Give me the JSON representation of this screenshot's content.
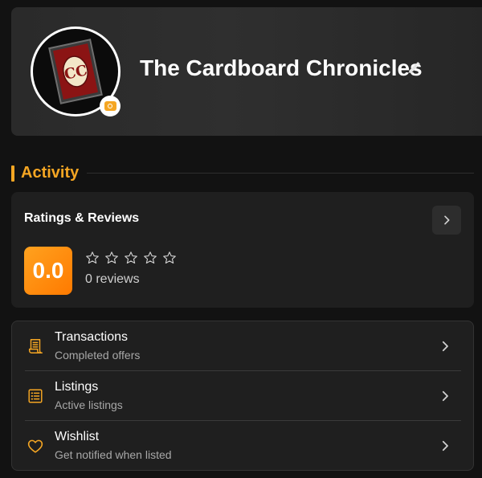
{
  "profile": {
    "name": "The Cardboard Chronicles",
    "avatar_monogram": "CC"
  },
  "activity": {
    "section_title": "Activity",
    "ratings": {
      "title": "Ratings & Reviews",
      "score": "0.0",
      "stars_filled": 0,
      "stars_total": 5,
      "review_count_text": "0 reviews"
    },
    "menu": [
      {
        "title": "Transactions",
        "subtitle": "Completed offers",
        "icon": "receipt-icon"
      },
      {
        "title": "Listings",
        "subtitle": "Active listings",
        "icon": "list-icon"
      },
      {
        "title": "Wishlist",
        "subtitle": "Get notified when listed",
        "icon": "heart-icon"
      }
    ]
  },
  "colors": {
    "accent": "#f5a623",
    "background": "#121212",
    "card": "#1f1f1f"
  }
}
